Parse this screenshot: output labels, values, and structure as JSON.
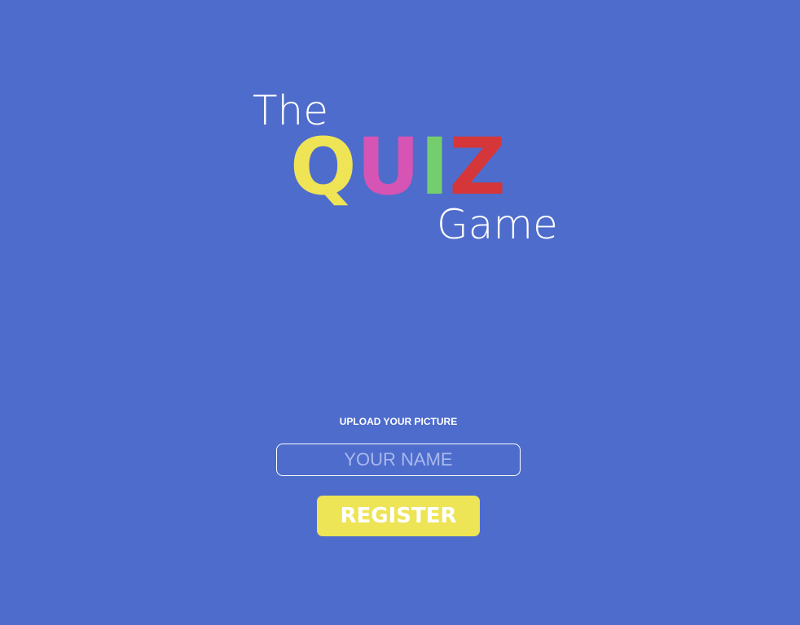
{
  "logo": {
    "the": "The",
    "quiz_letters": [
      {
        "char": "Q",
        "color": "#efe455"
      },
      {
        "char": "U",
        "color": "#d554b4"
      },
      {
        "char": "I",
        "color": "#74ce6e"
      },
      {
        "char": "Z",
        "color": "#d53639"
      }
    ],
    "game": "Game"
  },
  "form": {
    "upload_label": "UPLOAD YOUR PICTURE",
    "name_placeholder": "YOUR NAME",
    "name_value": "",
    "register_label": "REGISTER"
  },
  "colors": {
    "background": "#4e6ccb",
    "button": "#ede456",
    "text": "#ffffff"
  }
}
